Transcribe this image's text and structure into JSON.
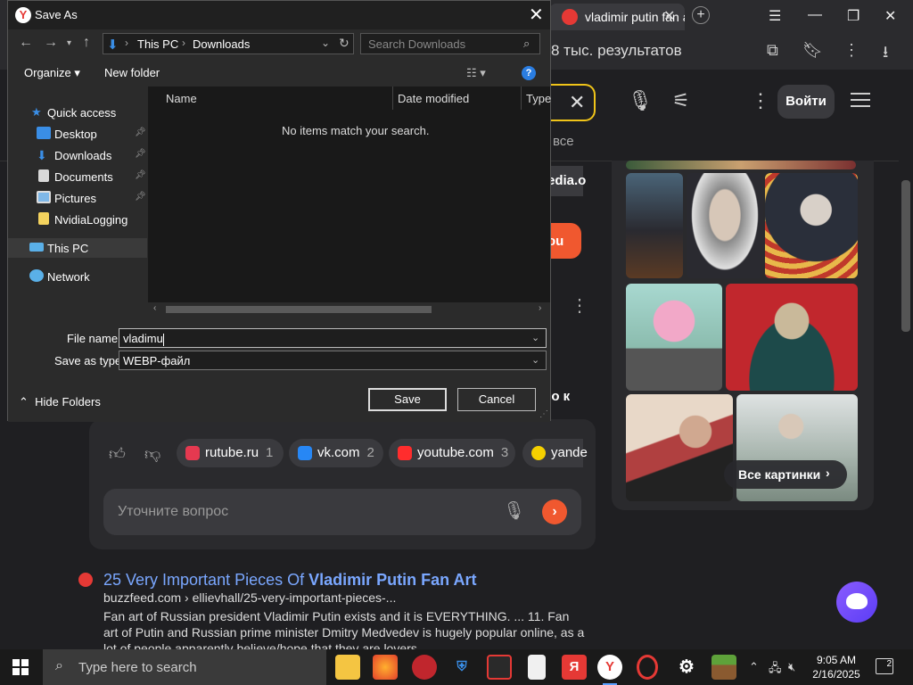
{
  "browser": {
    "tab_title": "vladimir putin fan a",
    "tab_close": "✕",
    "new_tab": "+",
    "results_count": "8 тыс. результатов",
    "login": "Войти",
    "fragments": {
      "frag_vse": "все",
      "frag_media": "edia.o",
      "frag_you": "ou",
      "frag_eo": "eo к"
    },
    "images_all": "Все картинки",
    "sources": [
      {
        "name": "rutube.ru",
        "count": "1",
        "color": "#e53950"
      },
      {
        "name": "vk.com",
        "count": "2",
        "color": "#2787f5"
      },
      {
        "name": "youtube.com",
        "count": "3",
        "color": "#ff2d2d"
      },
      {
        "name": "yande",
        "count": "",
        "color": "#f5d000"
      }
    ],
    "refine_placeholder": "Уточните вопрос",
    "result": {
      "title_prefix": "25 Very Important Pieces Of ",
      "title_bold": "Vladimir Putin Fan Art",
      "url": "buzzfeed.com › ellievhall/25-very-important-pieces-...",
      "snippet": "Fan art of Russian president Vladimir Putin exists and it is EVERYTHING. ... 11. Fan art of Putin and Russian prime minister Dmitry Medvedev is hugely popular online, as a lot of people apparently believe/hope that they are lovers."
    },
    "colors": {
      "accent_search": "#f0c419",
      "link": "#7aa7ff",
      "go": "#f0582f"
    }
  },
  "dialog": {
    "title": "Save As",
    "path": [
      "This PC",
      "Downloads"
    ],
    "search_placeholder": "Search Downloads",
    "organize": "Organize ▾",
    "new_folder": "New folder",
    "help": "?",
    "nav": [
      {
        "label": "Quick access",
        "icon": "star-icon",
        "color": "#3a8ee6",
        "pinned": false
      },
      {
        "label": "Desktop",
        "icon": "desktop-icon",
        "color": "#3a8ee6",
        "pinned": true
      },
      {
        "label": "Downloads",
        "icon": "download-icon",
        "color": "#3a8ee6",
        "pinned": true
      },
      {
        "label": "Documents",
        "icon": "document-icon",
        "color": "#d9d9d9",
        "pinned": true
      },
      {
        "label": "Pictures",
        "icon": "pictures-icon",
        "color": "#7fb8e8",
        "pinned": true
      },
      {
        "label": "NvidiaLogging",
        "icon": "folder-icon",
        "color": "#f4d35e",
        "pinned": false
      },
      {
        "label": "This PC",
        "icon": "computer-icon",
        "color": "#5ab0e8",
        "pinned": false
      },
      {
        "label": "Network",
        "icon": "network-icon",
        "color": "#5ab0e8",
        "pinned": false
      }
    ],
    "columns": [
      "Name",
      "Date modified",
      "Type"
    ],
    "empty_message": "No items match your search.",
    "file_name_label": "File name:",
    "file_name_value": "vladimu",
    "save_type_label": "Save as type:",
    "save_type_value": "WEBP-файл",
    "hide_folders": "Hide Folders",
    "save": "Save",
    "cancel": "Cancel"
  },
  "taskbar": {
    "search_placeholder": "Type here to search",
    "time": "9:05 AM",
    "date": "2/16/2025",
    "notifications": "2",
    "apps": [
      "file-explorer-icon",
      "firefox-icon",
      "app-red-icon",
      "shield-icon",
      "video-editor-icon",
      "notepad-icon",
      "yandex-icon",
      "yandex-browser-icon",
      "opera-icon",
      "settings-icon",
      "minecraft-icon"
    ]
  }
}
